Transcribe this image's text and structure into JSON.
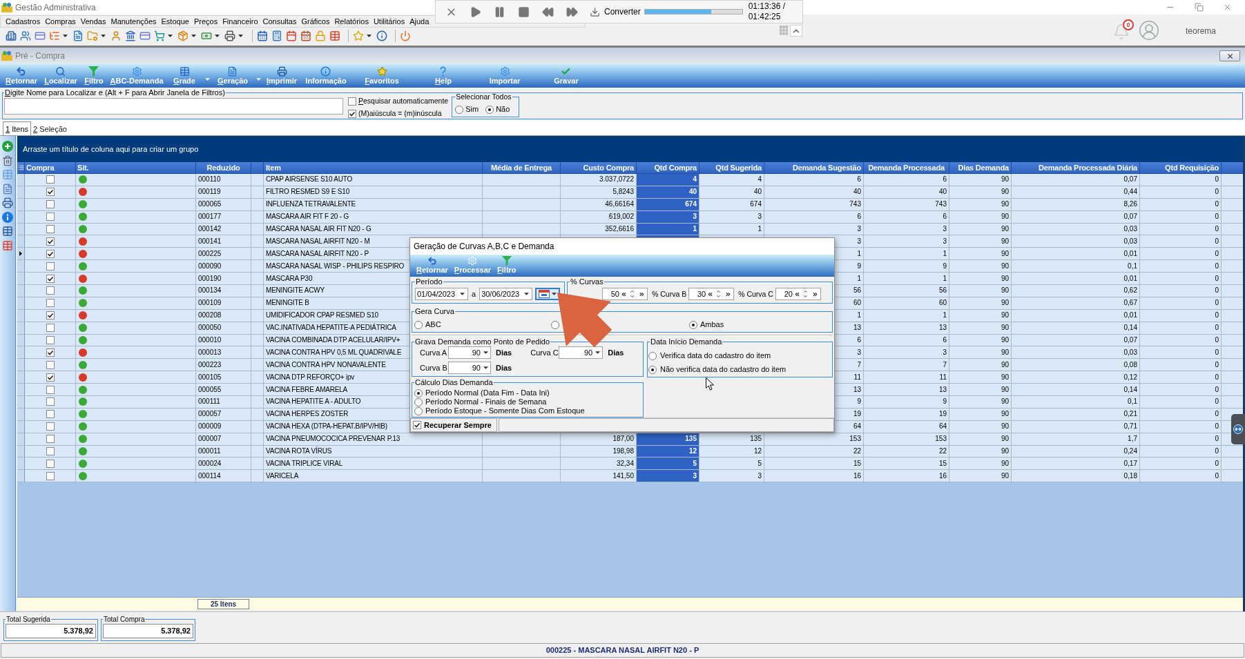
{
  "app": {
    "title": "Gestão Administrativa",
    "menu": [
      "Cadastros",
      "Compras",
      "Vendas",
      "Manutenções",
      "Estoque",
      "Preços",
      "Financeiro",
      "Consultas",
      "Gráficos",
      "Relatórios",
      "Utilitários",
      "Ajuda"
    ],
    "notifications": "0",
    "user": "teorema"
  },
  "media_player": {
    "action": "Converter",
    "level": 0.68,
    "elapsed": "01:13:36 /",
    "duration": "01:42:25"
  },
  "window": {
    "title": "Pré - Compra"
  },
  "toolbar": [
    {
      "label": "Retornar",
      "mnemonic": true,
      "dropdown": false
    },
    {
      "label": "Localizar",
      "mnemonic": true,
      "dropdown": false
    },
    {
      "label": "Filtro",
      "mnemonic": true,
      "dropdown": false
    },
    {
      "label": "ABC-Demanda",
      "mnemonic": true,
      "dropdown": false
    },
    {
      "label": "Grade",
      "mnemonic": true,
      "dropdown": true
    },
    {
      "label": "Geração",
      "mnemonic": true,
      "dropdown": true
    },
    {
      "label": "Imprimir",
      "mnemonic": true,
      "dropdown": false
    },
    {
      "label": "Informação",
      "mnemonic": false,
      "dropdown": false
    },
    {
      "label": "Favoritos",
      "mnemonic": true,
      "dropdown": false
    },
    {
      "label": "Help",
      "mnemonic": true,
      "dropdown": false
    },
    {
      "label": "Importar",
      "mnemonic": false,
      "dropdown": false
    },
    {
      "label": "Gravar",
      "mnemonic": false,
      "dropdown": false
    }
  ],
  "search": {
    "label": "Digite Nome para Localizar e (Alt + F para Abrir Janela de Filtros)",
    "mnemonic": true,
    "options": [
      {
        "label": "Pesquisar automaticamente",
        "mnemonic": true,
        "checked": false
      },
      {
        "label": "(M)aiúscula = (m)inúscula",
        "mnemonic": false,
        "checked": true
      }
    ],
    "select_all": {
      "label": "Selecionar Todos",
      "options": [
        {
          "label": "Sim",
          "selected": false
        },
        {
          "label": "Não",
          "selected": true
        }
      ]
    }
  },
  "tabs": [
    {
      "label": "1 Itens",
      "mnemonic": true,
      "selected": true
    },
    {
      "label": "2 Seleção",
      "mnemonic": true,
      "selected": false
    }
  ],
  "grid": {
    "group_hint": "Arraste um título de coluna aqui para criar um grupo",
    "columns": [
      {
        "label": "Compra",
        "selected": false
      },
      {
        "label": "Sit.",
        "selected": false
      },
      {
        "label": "Reduzido",
        "selected": false
      },
      {
        "label": "Item",
        "selected": false
      },
      {
        "label": "Média de Entrega",
        "selected": false
      },
      {
        "label": "Custo Compra",
        "selected": false
      },
      {
        "label": "Qtd Compra",
        "selected": true
      },
      {
        "label": "Qtd Sugerida",
        "selected": false
      },
      {
        "label": "Demanda Sugestão",
        "selected": false
      },
      {
        "label": "Demanda Processada",
        "selected": false
      },
      {
        "label": "Dias Demanda",
        "selected": false
      },
      {
        "label": "Demanda Processada Diária",
        "selected": false
      },
      {
        "label": "Qtd Requisição",
        "selected": false
      }
    ],
    "rows": [
      {
        "selected": false,
        "checked": false,
        "color": "#3aa935",
        "reduzido": "000110",
        "item": "CPAP AIRSENSE S10 AUTO",
        "custo_compra": "3.037,0722",
        "qtd_compra": "4",
        "qtd_sugerida": "4",
        "demanda_sugestao": "6",
        "demanda_processada": "6",
        "dias_demanda": "90",
        "demanda_processada_diaria": "0,07",
        "qtd_requisicao": "0"
      },
      {
        "selected": false,
        "checked": true,
        "color": "#d83a2a",
        "reduzido": "000119",
        "item": "FILTRO RESMED S9 E S10",
        "custo_compra": "5,8243",
        "qtd_compra": "40",
        "qtd_sugerida": "40",
        "demanda_sugestao": "40",
        "demanda_processada": "40",
        "dias_demanda": "90",
        "demanda_processada_diaria": "0,44",
        "qtd_requisicao": "0"
      },
      {
        "selected": false,
        "checked": false,
        "color": "#3aa935",
        "reduzido": "000065",
        "item": "INFLUENZA TETRAVALENTE",
        "custo_compra": "46,66164",
        "qtd_compra": "674",
        "qtd_sugerida": "674",
        "demanda_sugestao": "743",
        "demanda_processada": "743",
        "dias_demanda": "90",
        "demanda_processada_diaria": "8,26",
        "qtd_requisicao": "0"
      },
      {
        "selected": false,
        "checked": false,
        "color": "#3aa935",
        "reduzido": "000177",
        "item": "MASCARA AIR FIT F 20 - G",
        "custo_compra": "619,002",
        "qtd_compra": "3",
        "qtd_sugerida": "3",
        "demanda_sugestao": "6",
        "demanda_processada": "6",
        "dias_demanda": "90",
        "demanda_processada_diaria": "0,07",
        "qtd_requisicao": "0"
      },
      {
        "selected": false,
        "checked": false,
        "color": "#3aa935",
        "reduzido": "000142",
        "item": "MASCARA NASAL AIR FIT N20 - G",
        "custo_compra": "352,6616",
        "qtd_compra": "1",
        "qtd_sugerida": "1",
        "demanda_sugestao": "3",
        "demanda_processada": "3",
        "dias_demanda": "90",
        "demanda_processada_diaria": "0,03",
        "qtd_requisicao": "0"
      },
      {
        "selected": false,
        "checked": true,
        "color": "#d83a2a",
        "reduzido": "000141",
        "item": "MASCARA NASAL AIRFIT N20 - M",
        "demanda_sugestao": "3",
        "demanda_processada": "3",
        "dias_demanda": "90",
        "demanda_processada_diaria": "0,03",
        "qtd_requisicao": "0"
      },
      {
        "selected": true,
        "checked": true,
        "color": "#d83a2a",
        "reduzido": "000225",
        "item": "MASCARA NASAL AIRFIT N20 - P",
        "demanda_sugestao": "1",
        "demanda_processada": "1",
        "dias_demanda": "90",
        "demanda_processada_diaria": "0,01",
        "qtd_requisicao": "0"
      },
      {
        "selected": false,
        "checked": false,
        "color": "#3aa935",
        "reduzido": "000090",
        "item": "MASCARA NASAL WISP - PHILIPS RESPIRO",
        "demanda_sugestao": "9",
        "demanda_processada": "9",
        "dias_demanda": "90",
        "demanda_processada_diaria": "0,1",
        "qtd_requisicao": "0"
      },
      {
        "selected": false,
        "checked": true,
        "color": "#d83a2a",
        "reduzido": "000190",
        "item": "MASCARA P30",
        "demanda_sugestao": "1",
        "demanda_processada": "1",
        "dias_demanda": "90",
        "demanda_processada_diaria": "0,01",
        "qtd_requisicao": "0"
      },
      {
        "selected": false,
        "checked": false,
        "color": "#3aa935",
        "reduzido": "000134",
        "item": "MENINGITE ACWY",
        "demanda_sugestao": "56",
        "demanda_processada": "56",
        "dias_demanda": "90",
        "demanda_processada_diaria": "0,62",
        "qtd_requisicao": "0"
      },
      {
        "selected": false,
        "checked": false,
        "color": "#3aa935",
        "reduzido": "000109",
        "item": "MENINGITE B",
        "demanda_sugestao": "60",
        "demanda_processada": "60",
        "dias_demanda": "90",
        "demanda_processada_diaria": "0,67",
        "qtd_requisicao": "0"
      },
      {
        "selected": false,
        "checked": true,
        "color": "#d83a2a",
        "reduzido": "000208",
        "item": "UMIDIFICADOR CPAP RESMED S10",
        "demanda_sugestao": "1",
        "demanda_processada": "1",
        "dias_demanda": "90",
        "demanda_processada_diaria": "0,01",
        "qtd_requisicao": "0"
      },
      {
        "selected": false,
        "checked": false,
        "color": "#3aa935",
        "reduzido": "000050",
        "item": "VAC.INATIVADA HEPATITE-A PEDIÁTRICA",
        "demanda_sugestao": "13",
        "demanda_processada": "13",
        "dias_demanda": "90",
        "demanda_processada_diaria": "0,14",
        "qtd_requisicao": "0"
      },
      {
        "selected": false,
        "checked": false,
        "color": "#3aa935",
        "reduzido": "000010",
        "item": "VACINA COMBINADA DTP ACELULAR/IPV+",
        "demanda_sugestao": "6",
        "demanda_processada": "6",
        "dias_demanda": "90",
        "demanda_processada_diaria": "0,07",
        "qtd_requisicao": "0"
      },
      {
        "selected": false,
        "checked": true,
        "color": "#d83a2a",
        "reduzido": "000013",
        "item": "VACINA CONTRA HPV 0,5 ML QUADRIVALE",
        "demanda_sugestao": "3",
        "demanda_processada": "3",
        "dias_demanda": "90",
        "demanda_processada_diaria": "0,03",
        "qtd_requisicao": "0"
      },
      {
        "selected": false,
        "checked": false,
        "color": "#3aa935",
        "reduzido": "000223",
        "item": "VACINA CONTRA HPV NONAVALENTE",
        "demanda_sugestao": "7",
        "demanda_processada": "7",
        "dias_demanda": "90",
        "demanda_processada_diaria": "0,08",
        "qtd_requisicao": "0"
      },
      {
        "selected": false,
        "checked": true,
        "color": "#d83a2a",
        "reduzido": "000105",
        "item": "VACINA DTP REFORÇO+ ipv",
        "demanda_sugestao": "11",
        "demanda_processada": "11",
        "dias_demanda": "90",
        "demanda_processada_diaria": "0,12",
        "qtd_requisicao": "0"
      },
      {
        "selected": false,
        "checked": false,
        "color": "#3aa935",
        "reduzido": "000055",
        "item": "VACINA FEBRE AMARELA",
        "demanda_sugestao": "13",
        "demanda_processada": "13",
        "dias_demanda": "90",
        "demanda_processada_diaria": "0,14",
        "qtd_requisicao": "0"
      },
      {
        "selected": false,
        "checked": false,
        "color": "#3aa935",
        "reduzido": "000111",
        "item": "VACINA HEPATITE A - ADULTO",
        "demanda_sugestao": "9",
        "demanda_processada": "9",
        "dias_demanda": "90",
        "demanda_processada_diaria": "0,1",
        "qtd_requisicao": "0"
      },
      {
        "selected": false,
        "checked": false,
        "color": "#3aa935",
        "reduzido": "000057",
        "item": "VACINA HERPES ZOSTER",
        "demanda_sugestao": "19",
        "demanda_processada": "19",
        "dias_demanda": "90",
        "demanda_processada_diaria": "0,21",
        "qtd_requisicao": "0"
      },
      {
        "selected": false,
        "checked": false,
        "color": "#3aa935",
        "reduzido": "000009",
        "item": "VACINA HEXA (DTPA-HEPAT.B/IPV/HIB)",
        "demanda_sugestao": "64",
        "demanda_processada": "64",
        "dias_demanda": "90",
        "demanda_processada_diaria": "0,71",
        "qtd_requisicao": "0"
      },
      {
        "selected": false,
        "checked": false,
        "color": "#3aa935",
        "reduzido": "000007",
        "item": "VACINA PNEUMOCOCICA PREVENAR P.13",
        "custo_compra": "187,00",
        "qtd_compra": "135",
        "qtd_sugerida": "135",
        "demanda_sugestao": "153",
        "demanda_processada": "153",
        "dias_demanda": "90",
        "demanda_processada_diaria": "1,7",
        "qtd_requisicao": "0"
      },
      {
        "selected": false,
        "checked": false,
        "color": "#3aa935",
        "reduzido": "000011",
        "item": "VACINA ROTA VÍRUS",
        "custo_compra": "198,98",
        "qtd_compra": "12",
        "qtd_sugerida": "12",
        "demanda_sugestao": "22",
        "demanda_processada": "22",
        "dias_demanda": "90",
        "demanda_processada_diaria": "0,24",
        "qtd_requisicao": "0"
      },
      {
        "selected": false,
        "checked": false,
        "color": "#3aa935",
        "reduzido": "000024",
        "item": "VACINA TRIPLICE VIRAL",
        "custo_compra": "32,34",
        "qtd_compra": "5",
        "qtd_sugerida": "5",
        "demanda_sugestao": "15",
        "demanda_processada": "15",
        "dias_demanda": "90",
        "demanda_processada_diaria": "0,17",
        "qtd_requisicao": "0"
      },
      {
        "selected": false,
        "checked": false,
        "color": "#3aa935",
        "reduzido": "000114",
        "item": "VARICELA",
        "custo_compra": "141,50",
        "qtd_compra": "3",
        "qtd_sugerida": "3",
        "demanda_sugestao": "16",
        "demanda_processada": "16",
        "dias_demanda": "90",
        "demanda_processada_diaria": "0,18",
        "qtd_requisicao": "0"
      }
    ],
    "footer": "25 Itens"
  },
  "totals": [
    {
      "label": "Total Sugerida",
      "value": "5.378,92"
    },
    {
      "label": "Total Compra",
      "value": "5.378,92"
    }
  ],
  "status_bar": "000225 - MASCARA NASAL AIRFIT N20 - P",
  "dialog": {
    "title": "Geração de Curvas A,B,C e Demanda",
    "toolbar": [
      {
        "label": "Retornar",
        "mnemonic": true
      },
      {
        "label": "Processar",
        "mnemonic": true
      },
      {
        "label": "Filtro",
        "mnemonic": true
      }
    ],
    "periodo": {
      "label": "Período",
      "from": "01/04/2023",
      "separator": "a",
      "to": "30/06/2023"
    },
    "curvas": {
      "label": "% Curvas",
      "fields": [
        {
          "value": "50"
        },
        {
          "label": "% Curva B",
          "value": "30"
        },
        {
          "label": "% Curva C",
          "value": "20"
        }
      ]
    },
    "gera_curva": {
      "label": "Gera Curva",
      "options": [
        {
          "label": "ABC",
          "selected": false
        },
        {
          "selected": false
        },
        {
          "label": "Ambas",
          "selected": true
        }
      ]
    },
    "grava_demanda": {
      "label": "Grava Demanda como Ponto de Pedido",
      "fields": [
        {
          "label": "Curva A",
          "value": "90",
          "unit": "Dias"
        },
        {
          "label": "Curva C",
          "value": "90",
          "unit": "Dias"
        },
        {
          "label": "Curva B",
          "value": "90",
          "unit": "Dias"
        }
      ]
    },
    "data_inicio": {
      "label": "Data Início Demanda",
      "options": [
        {
          "label": "Verifica data do cadastro do item",
          "selected": false
        },
        {
          "label": "Não verifica data do cadastro do item",
          "selected": true
        }
      ]
    },
    "calculo_dias": {
      "label": "Cálculo Dias Demanda",
      "options": [
        {
          "label": "Período Normal (Data Fim - Data Ini)",
          "selected": true
        },
        {
          "label": "Período Normal - Finais de Semana",
          "selected": false
        },
        {
          "label": "Período Estoque - Somente Dias Com Estoque",
          "selected": false
        }
      ]
    },
    "recuperar_sempre": {
      "label": "Recuperar Sempre",
      "checked": true
    }
  }
}
